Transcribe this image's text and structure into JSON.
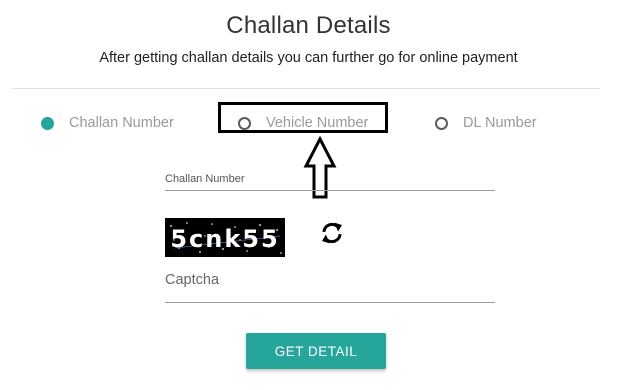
{
  "header": {
    "title": "Challan Details",
    "subtitle": "After getting challan details you can further go for online payment"
  },
  "search_type": {
    "options": [
      {
        "label": "Challan Number",
        "selected": true
      },
      {
        "label": "Vehicle Number",
        "selected": false,
        "highlighted": true
      },
      {
        "label": "DL Number",
        "selected": false
      }
    ]
  },
  "form": {
    "challan_label": "Challan Number",
    "captcha_text": "5cnk55",
    "captcha_label": "Captcha",
    "submit_label": "GET DETAIL"
  },
  "colors": {
    "accent": "#26a69a",
    "captcha_bg": "#000000",
    "highlight_border": "#000000"
  },
  "icons": {
    "refresh": "refresh-icon",
    "annotation": "up-arrow-icon"
  }
}
